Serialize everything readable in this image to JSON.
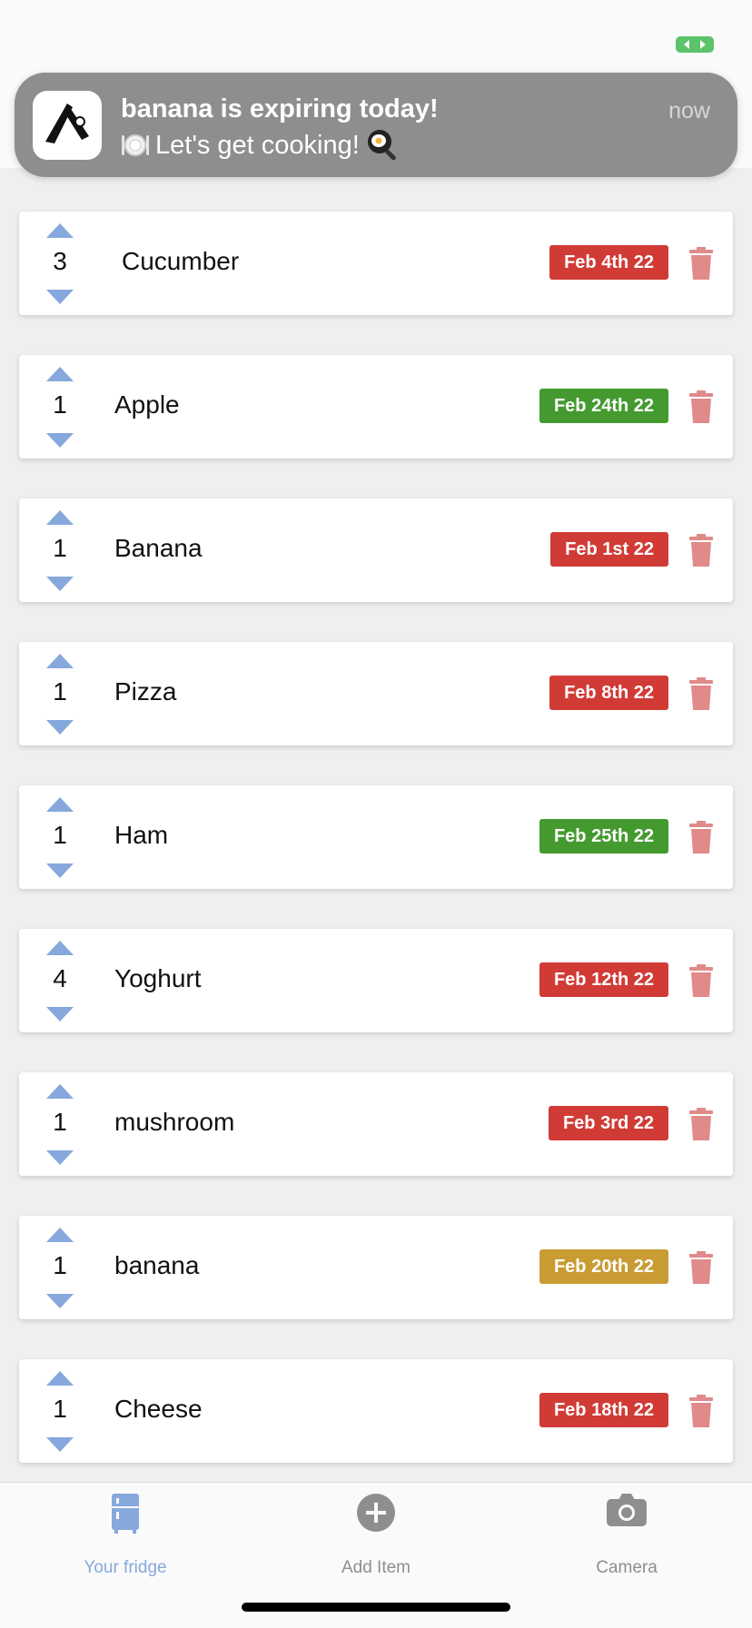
{
  "notification": {
    "app_icon": "app-logo-icon",
    "title": "banana is expiring today!",
    "body": "Let's get cooking!",
    "body_icons": [
      "plate-cutlery-icon",
      "frying-pan-egg-icon"
    ],
    "time": "now"
  },
  "items": [
    {
      "qty": "3",
      "name": "Cucumber",
      "date": "Feb 4th 22",
      "status_color": "#d13b36"
    },
    {
      "qty": "1",
      "name": "Apple",
      "date": "Feb 24th 22",
      "status_color": "#449a2f"
    },
    {
      "qty": "1",
      "name": "Banana",
      "date": "Feb 1st 22",
      "status_color": "#d13b36"
    },
    {
      "qty": "1",
      "name": "Pizza",
      "date": "Feb 8th 22",
      "status_color": "#d13b36"
    },
    {
      "qty": "1",
      "name": "Ham",
      "date": "Feb 25th 22",
      "status_color": "#449a2f"
    },
    {
      "qty": "4",
      "name": "Yoghurt",
      "date": "Feb 12th 22",
      "status_color": "#d13b36"
    },
    {
      "qty": "1",
      "name": "mushroom",
      "date": "Feb 3rd 22",
      "status_color": "#d13b36"
    },
    {
      "qty": "1",
      "name": "banana",
      "date": "Feb 20th 22",
      "status_color": "#c99c33"
    },
    {
      "qty": "1",
      "name": "Cheese",
      "date": "Feb 18th 22",
      "status_color": "#d13b36"
    }
  ],
  "tabs": [
    {
      "label": "Your fridge",
      "icon": "fridge-icon",
      "active": true
    },
    {
      "label": "Add Item",
      "icon": "plus-circle-icon",
      "active": false
    },
    {
      "label": "Camera",
      "icon": "camera-icon",
      "active": false
    }
  ],
  "colors": {
    "accent": "#86a8dc",
    "trash": "#e08a8a",
    "expired": "#d13b36",
    "fresh": "#449a2f",
    "soon": "#c99c33"
  }
}
